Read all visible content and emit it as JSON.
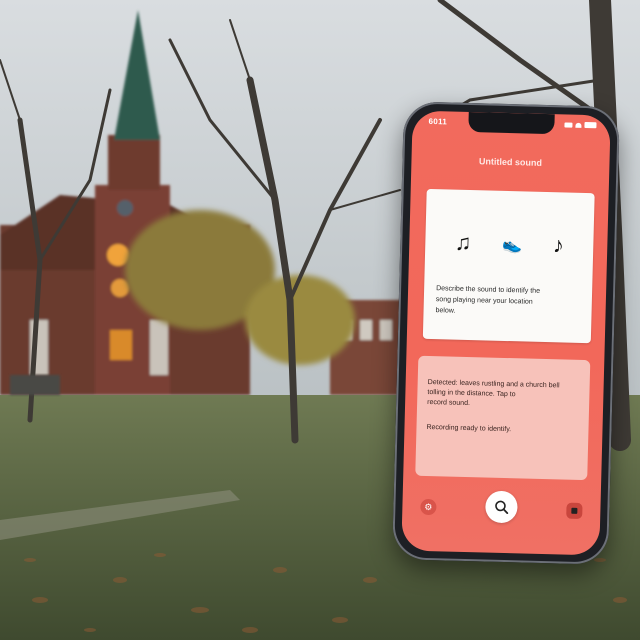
{
  "phone": {
    "status_time": "6011",
    "app_title": "Untitled sound",
    "top_card": {
      "icons": [
        "music-note-icon",
        "shoe-icon",
        "music-note-icon"
      ],
      "text_line_1": "Describe the sound to identify the",
      "text_line_2": "song playing near your location",
      "text_line_3": "below."
    },
    "bottom_card": {
      "text_line_1": "Detected: leaves rustling and a church bell",
      "text_line_2": "tolling in the distance. Tap to",
      "text_line_3": "record sound.",
      "sub_text": "Recording ready to identify."
    },
    "nav": {
      "left_icon": "settings-icon",
      "center_icon": "search-icon",
      "right_icon": "stop-icon"
    }
  },
  "colors": {
    "screen_accent": "#f26a5d",
    "card_bottom": "#f7c2ba",
    "card_top": "#fbfaf8"
  }
}
